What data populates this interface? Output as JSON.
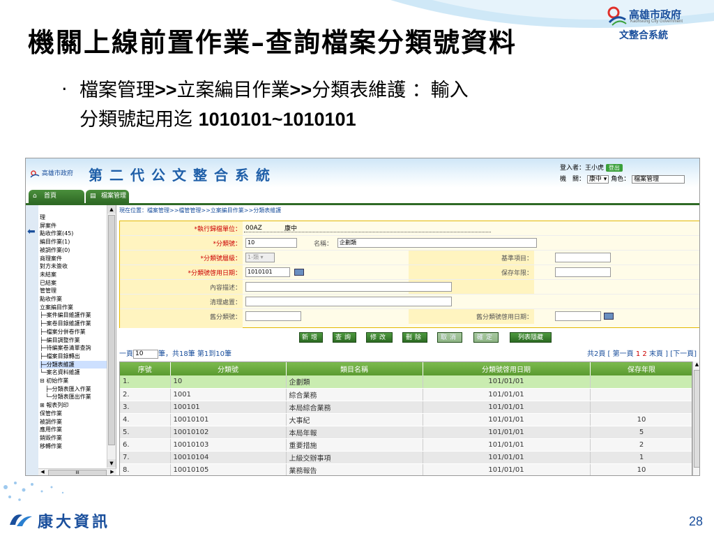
{
  "slide": {
    "title": "機關上線前置作業–查詢檔案分類號資料",
    "bullet_dot": "‧",
    "bullet_line1_a": "檔案管理",
    "bullet_line1_b": ">>",
    "bullet_line1_c": "立案編目作業",
    "bullet_line1_d": ">>",
    "bullet_line1_e": "分類表維護 ：輸入",
    "bullet_line2_a": "分類號起用迄 ",
    "bullet_line2_b": "1010101~1010101",
    "page_number": "28",
    "brand_city": "高雄市政府",
    "brand_city_en": "Kaohsiung City Government",
    "brand_system": "文整合系統",
    "footer_company": "康大資訊"
  },
  "app": {
    "logo_text": "高雄市政府",
    "title": "第二代公文整合系統",
    "login_label": "登入者：",
    "login_user": "王小虎",
    "logout": "登出",
    "agency_label": "機　關：",
    "agency_value": "康中",
    "role_label": "角色：",
    "role_value": "檔案管理",
    "tab_home": "首頁",
    "tab_archive": "檔案管理"
  },
  "tree": [
    "理",
    "屏案件",
    "點收作業(45)",
    "編目作業(1)",
    "被調作業(0)",
    "商理案件",
    "對方未簽收",
    "未結案",
    "已結案",
    "管管理",
    "點收作業",
    "立案編目作業",
    "├─案件編目維護作業",
    "├─案卷目錄維護作業",
    "├─檔案分併卷作業",
    "├─編目調整作業",
    "├─待編案卷清單查詢",
    "├─檔案目錄轉出",
    "├─分類表維護",
    "└─案名資料維護",
    "⊟ 初始作業",
    "　├─分類表匯入作業",
    "　└─分類表匯出作業",
    "⊞ 報表列印",
    "保管作業",
    "被調作業",
    "應用作業",
    "銷毀作業",
    "移轉作業"
  ],
  "tree_selected_index": 18,
  "breadcrumb": "現在位置：檔案管理>>檔管管理>>立案編目作業>>分類表維護",
  "form": {
    "unit_label": "*執行歸檔單位：",
    "unit_code": "00AZ",
    "unit_name": "康中",
    "class_no_label": "*分類號：",
    "class_no_value": "10",
    "name_label": "名稱：",
    "name_value": "企劃類",
    "level_label": "*分類號層級：",
    "level_value": "1-類",
    "base_item_label": "基準項目：",
    "start_date_label": "*分類號啓用日期：",
    "start_date_value": "1010101",
    "retention_label": "保存年限：",
    "desc_label": "內容描述：",
    "clear_label": "清理處置：",
    "old_class_label": "舊分類號：",
    "old_start_label": "舊分類號啓用日期："
  },
  "buttons": [
    "新增",
    "查詢",
    "修改",
    "刪除",
    "取消",
    "確定",
    "列表隱藏"
  ],
  "pager": {
    "prev": "一頁",
    "page_input": "10",
    "summary": "筆，共18筆 第1到10筆",
    "total_pages": "共2頁",
    "first": "[ 第一頁",
    "p1": "1",
    "p2": "2",
    "last": "末頁 ] [下一頁]"
  },
  "grid": {
    "headers": [
      "序號",
      "分類號",
      "類目名稱",
      "分類號啓用日期",
      "保存年限"
    ],
    "rows": [
      [
        "1.",
        "10",
        "企劃類",
        "101/01/01",
        ""
      ],
      [
        "2.",
        "1001",
        "綜合業務",
        "101/01/01",
        ""
      ],
      [
        "3.",
        "100101",
        "本局綜合業務",
        "101/01/01",
        ""
      ],
      [
        "4.",
        "10010101",
        "大事紀",
        "101/01/01",
        "10"
      ],
      [
        "5.",
        "10010102",
        "本局年報",
        "101/01/01",
        "5"
      ],
      [
        "6.",
        "10010103",
        "重要措施",
        "101/01/01",
        "2"
      ],
      [
        "7.",
        "10010104",
        "上級交辦事項",
        "101/01/01",
        "1"
      ],
      [
        "8.",
        "10010105",
        "業務報告",
        "101/01/01",
        "10"
      ]
    ]
  }
}
